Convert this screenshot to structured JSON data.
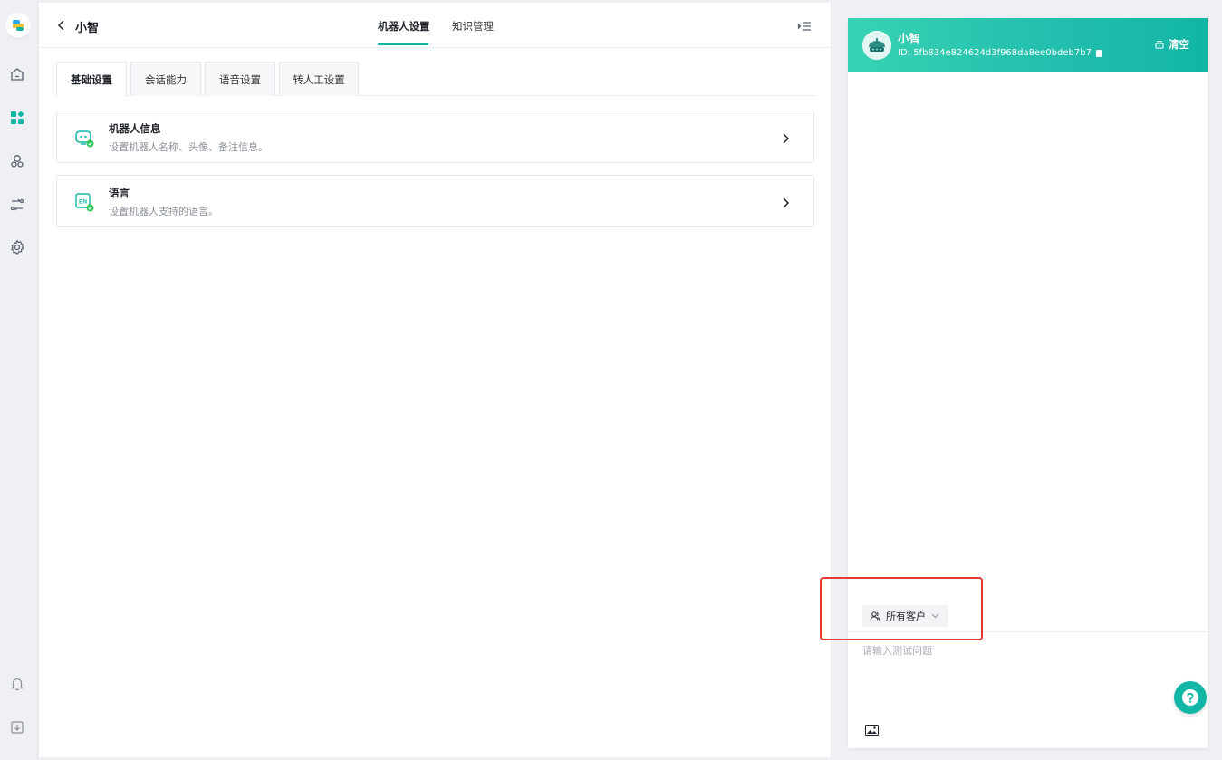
{
  "rail": {
    "icons": [
      "logo-icon",
      "home-icon",
      "apps-icon",
      "robot-icon",
      "flow-icon",
      "settings-icon",
      "bell-icon",
      "download-icon"
    ]
  },
  "header": {
    "bot_name": "小智",
    "tabs": [
      {
        "label": "机器人设置",
        "active": true
      },
      {
        "label": "知识管理",
        "active": false
      }
    ]
  },
  "subtabs": [
    {
      "label": "基础设置",
      "active": true
    },
    {
      "label": "会话能力",
      "active": false
    },
    {
      "label": "语音设置",
      "active": false
    },
    {
      "label": "转人工设置",
      "active": false
    }
  ],
  "cards": [
    {
      "title": "机器人信息",
      "desc": "设置机器人名称、头像、备注信息。",
      "icon": "robot-info-icon"
    },
    {
      "title": "语言",
      "desc": "设置机器人支持的语言。",
      "icon": "language-en-icon"
    }
  ],
  "chat": {
    "title": "小智",
    "id": "ID: 5fb834e824624d3f968da8ee0bdeb7b7",
    "clear_label": "清空",
    "audience_label": "所有客户",
    "input_placeholder": "请输入测试问题",
    "accent": "#12b6a5"
  },
  "colors": {
    "accent": "#12b6a5",
    "highlight": "#e13b33",
    "success": "#34c759"
  }
}
